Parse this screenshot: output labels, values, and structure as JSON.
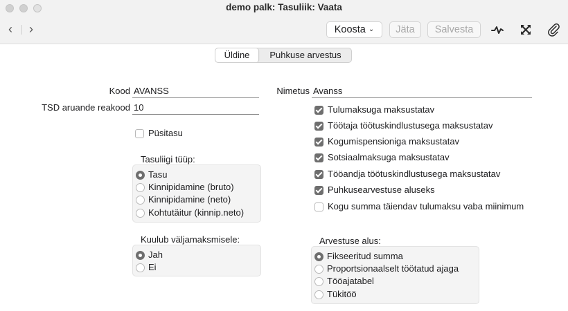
{
  "window": {
    "title": "demo palk: Tasuliik: Vaata"
  },
  "nav": {
    "back_icon": "chevron-left-icon",
    "forward_icon": "chevron-right-icon"
  },
  "toolbar": {
    "koosta_label": "Koosta",
    "jata_label": "Jäta",
    "salvesta_label": "Salvesta",
    "icons": [
      "activity-icon",
      "expand-icon",
      "paperclip-icon"
    ]
  },
  "tabs": [
    {
      "label": "Üldine",
      "selected": true
    },
    {
      "label": "Puhkuse arvestus",
      "selected": false
    }
  ],
  "fields": {
    "kood": {
      "label": "Kood",
      "value": "AVANSS"
    },
    "tsd": {
      "label": "TSD aruande reakood",
      "value": "10"
    },
    "nimetus": {
      "label": "Nimetus",
      "value": "Avanss"
    }
  },
  "pusitasu": {
    "label": "Püsitasu",
    "checked": false
  },
  "checkboxes": [
    {
      "label": "Tulumaksuga maksustatav",
      "checked": true
    },
    {
      "label": "Töötaja töötuskindlustusega maksustatav",
      "checked": true
    },
    {
      "label": "Kogumispensioniga maksustatav",
      "checked": true
    },
    {
      "label": "Sotsiaalmaksuga maksustatav",
      "checked": true
    },
    {
      "label": "Tööandja töötuskindlustusega maksustatav",
      "checked": true
    },
    {
      "label": "Puhkusearvestuse aluseks",
      "checked": true
    },
    {
      "label": "Kogu summa täiendav tulumaksu vaba miinimum",
      "checked": false
    }
  ],
  "tasuliigi_tyyp": {
    "label": "Tasuliigi tüüp:",
    "options": [
      {
        "label": "Tasu",
        "selected": true
      },
      {
        "label": "Kinnipidamine (bruto)",
        "selected": false
      },
      {
        "label": "Kinnipidamine (neto)",
        "selected": false
      },
      {
        "label": "Kohtutäitur (kinnip.neto)",
        "selected": false
      }
    ]
  },
  "valjamaks": {
    "label": "Kuulub väljamaksmisele:",
    "options": [
      {
        "label": "Jah",
        "selected": true
      },
      {
        "label": "Ei",
        "selected": false
      }
    ]
  },
  "arvestuse_alus": {
    "label": "Arvestuse alus:",
    "options": [
      {
        "label": "Fikseeritud summa",
        "selected": true
      },
      {
        "label": "Proportsionaalselt töötatud ajaga",
        "selected": false
      },
      {
        "label": "Tööajatabel",
        "selected": false
      },
      {
        "label": "Tükitöö",
        "selected": false
      }
    ]
  }
}
